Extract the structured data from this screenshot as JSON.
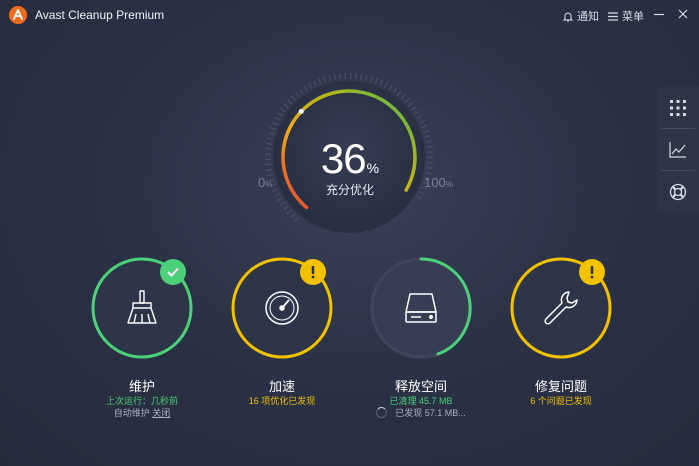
{
  "app": {
    "title": "Avast Cleanup Premium",
    "notify_label": "通知",
    "menu_label": "菜单"
  },
  "gauge": {
    "value": "36",
    "unit": "%",
    "label": "充分优化",
    "min_label": "0",
    "max_label": "100",
    "scale_unit": "%",
    "progress": 0.36
  },
  "tiles": [
    {
      "title": "维护",
      "status_label": "上次运行：",
      "status_value": "几秒前",
      "extra_prefix": "自动维护 ",
      "extra_link": "关闭",
      "state": "ok"
    },
    {
      "title": "加速",
      "status": "16 项优化已发现",
      "state": "warning"
    },
    {
      "title": "释放空间",
      "status": "已清理 45.7 MB",
      "extra": "已发现 57.1 MB...",
      "state": "scanning"
    },
    {
      "title": "修复问题",
      "status": "6 个问题已发现",
      "state": "warning"
    }
  ],
  "side_panel": [
    "apps-grid-icon",
    "chart-icon",
    "lifebuoy-icon"
  ],
  "colors": {
    "green": "#4cd07a",
    "yellow": "#f2c200",
    "background": "#2c3246",
    "red": "#e0442f"
  }
}
